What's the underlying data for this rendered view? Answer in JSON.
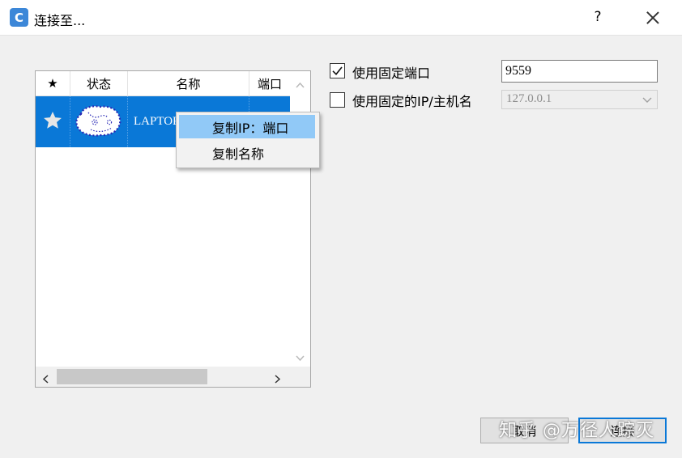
{
  "window": {
    "icon_letter": "C",
    "title": "连接至...",
    "help_label": "?"
  },
  "list": {
    "columns": [
      "★",
      "状态",
      "名称",
      "端口"
    ],
    "rows": [
      {
        "favorite": "★",
        "status_icon": "device-avatar-icon",
        "name": "LAPTOP",
        "port": ""
      }
    ],
    "selected_row_color": "#0a78d7"
  },
  "context_menu": {
    "items": [
      "复制IP：端口",
      "复制名称"
    ],
    "highlighted_index": 0,
    "highlight_color": "#91c9f7"
  },
  "options": {
    "fixed_port": {
      "label": "使用固定端口",
      "checked": true,
      "value": "9559"
    },
    "fixed_ip": {
      "label": "使用固定的IP/主机名",
      "checked": false,
      "value": "127.0.0.1"
    }
  },
  "buttons": {
    "cancel": "取消",
    "connect": "连接"
  },
  "watermark": "知乎 @万径人踪灭"
}
